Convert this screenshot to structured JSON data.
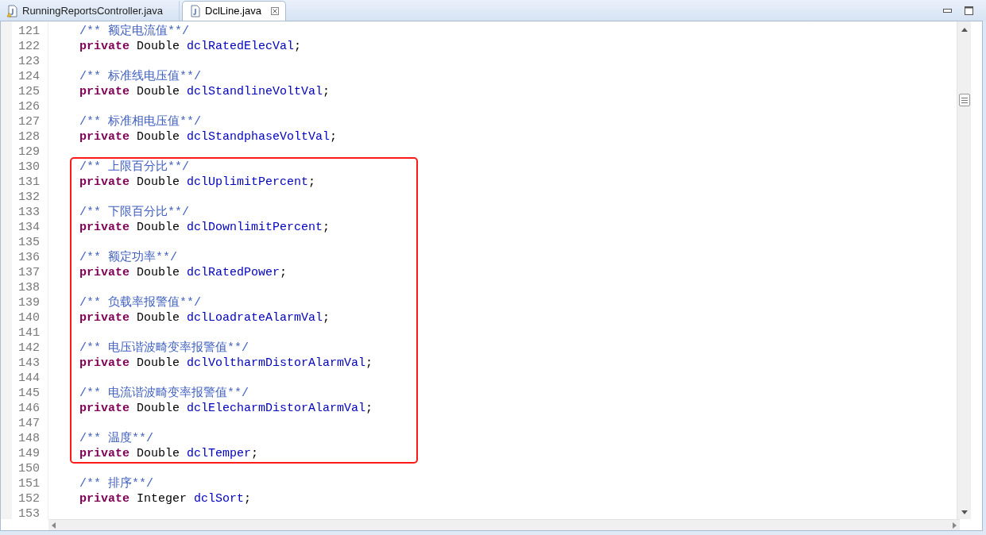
{
  "tabs": [
    {
      "label": "RunningReportsController.java",
      "selected": false,
      "warning": true
    },
    {
      "label": "DclLine.java",
      "selected": true,
      "warning": false
    }
  ],
  "blocks": [
    {
      "boxed": false,
      "lines": [
        {
          "number": "121",
          "kind": "comment",
          "text": "/** 额定电流值**/"
        },
        {
          "number": "122",
          "kind": "field",
          "modifier": "private",
          "type": "Double",
          "name": "dclRatedElecVal",
          "punct": ";"
        },
        {
          "number": "123",
          "kind": "blank"
        },
        {
          "number": "124",
          "kind": "comment",
          "text": "/** 标准线电压值**/"
        },
        {
          "number": "125",
          "kind": "field",
          "modifier": "private",
          "type": "Double",
          "name": "dclStandlineVoltVal",
          "punct": ";"
        },
        {
          "number": "126",
          "kind": "blank"
        },
        {
          "number": "127",
          "kind": "comment",
          "text": "/** 标准相电压值**/"
        },
        {
          "number": "128",
          "kind": "field",
          "modifier": "private",
          "type": "Double",
          "name": "dclStandphaseVoltVal",
          "punct": ";"
        },
        {
          "number": "129",
          "kind": "blank"
        }
      ]
    },
    {
      "boxed": true,
      "lines": [
        {
          "number": "130",
          "kind": "comment",
          "text": "/** 上限百分比**/"
        },
        {
          "number": "131",
          "kind": "field",
          "modifier": "private",
          "type": "Double",
          "name": "dclUplimitPercent",
          "punct": ";"
        },
        {
          "number": "132",
          "kind": "blank"
        },
        {
          "number": "133",
          "kind": "comment",
          "text": "/** 下限百分比**/"
        },
        {
          "number": "134",
          "kind": "field",
          "modifier": "private",
          "type": "Double",
          "name": "dclDownlimitPercent",
          "punct": ";"
        },
        {
          "number": "135",
          "kind": "blank"
        },
        {
          "number": "136",
          "kind": "comment",
          "text": "/** 额定功率**/"
        },
        {
          "number": "137",
          "kind": "field",
          "modifier": "private",
          "type": "Double",
          "name": "dclRatedPower",
          "punct": ";"
        },
        {
          "number": "138",
          "kind": "blank"
        },
        {
          "number": "139",
          "kind": "comment",
          "text": "/** 负载率报警值**/"
        },
        {
          "number": "140",
          "kind": "field",
          "modifier": "private",
          "type": "Double",
          "name": "dclLoadrateAlarmVal",
          "punct": ";"
        },
        {
          "number": "141",
          "kind": "blank"
        },
        {
          "number": "142",
          "kind": "comment",
          "text": "/** 电压谐波畸变率报警值**/"
        },
        {
          "number": "143",
          "kind": "field",
          "modifier": "private",
          "type": "Double",
          "name": "dclVoltharmDistorAlarmVal",
          "punct": ";"
        },
        {
          "number": "144",
          "kind": "blank"
        },
        {
          "number": "145",
          "kind": "comment",
          "text": "/** 电流谐波畸变率报警值**/"
        },
        {
          "number": "146",
          "kind": "field",
          "modifier": "private",
          "type": "Double",
          "name": "dclElecharmDistorAlarmVal",
          "punct": ";"
        },
        {
          "number": "147",
          "kind": "blank"
        },
        {
          "number": "148",
          "kind": "comment",
          "text": "/** 温度**/"
        },
        {
          "number": "149",
          "kind": "field",
          "modifier": "private",
          "type": "Double",
          "name": "dclTemper",
          "punct": ";"
        }
      ]
    },
    {
      "boxed": false,
      "lines": [
        {
          "number": "150",
          "kind": "blank"
        },
        {
          "number": "151",
          "kind": "comment",
          "text": "/** 排序**/"
        },
        {
          "number": "152",
          "kind": "field",
          "modifier": "private",
          "type": "Integer",
          "name": "dclSort",
          "punct": ";"
        },
        {
          "number": "153",
          "kind": "blank"
        }
      ]
    }
  ]
}
